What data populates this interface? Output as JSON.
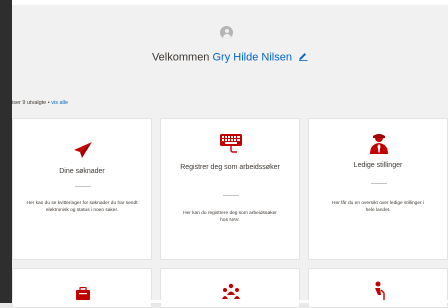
{
  "header": {
    "welcome_prefix": "Velkommen",
    "user_name": "Gry Hilde Nilsen"
  },
  "filter": {
    "text": "iser 9 utvalgte  •",
    "link": "vis alle"
  },
  "cards": [
    {
      "title": "Dine søknader",
      "description": "Her kan du se kvitteringer for søknader du har sendt elektronisk og status i noen saker."
    },
    {
      "title": "Registrer deg som arbeidssøker",
      "description": "Her kan du registrere deg som arbeidssøker hos NAV."
    },
    {
      "title": "Ledige stillinger",
      "description": "Her får du en oversikt over ledige stillinger i hele landet."
    }
  ],
  "colors": {
    "accent_red": "#c30000",
    "link_blue": "#0067c5"
  },
  "icons": {
    "card1": "paper-plane-icon",
    "card2": "keyboard-icon",
    "card3": "person-tie-icon",
    "card4": "briefcase-icon",
    "card5": "people-group-icon",
    "card6": "elderly-person-icon"
  }
}
